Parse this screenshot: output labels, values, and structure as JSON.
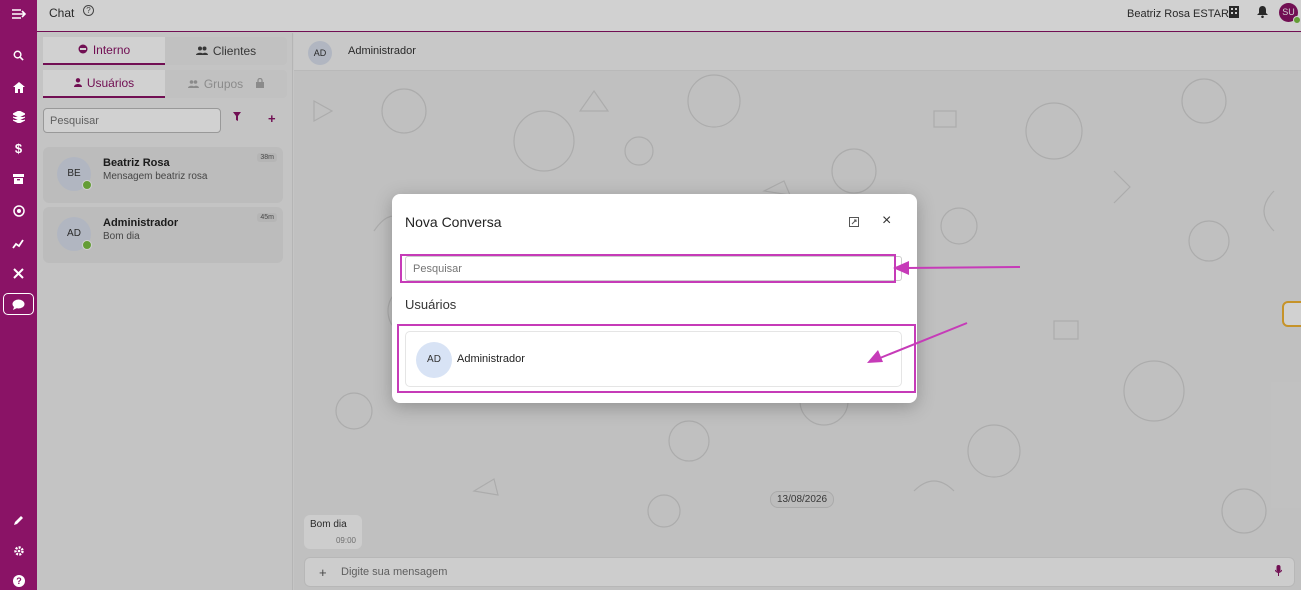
{
  "colors": {
    "brand": "#8a1366",
    "online": "#7bc043",
    "highlight": "#c63bb8",
    "accent_yellow": "#f2b433"
  },
  "rail": {
    "icons": [
      "menu-collapse-icon",
      "search-icon",
      "home-icon",
      "layers-icon",
      "dollar-icon",
      "archive-icon",
      "target-icon",
      "chart-icon",
      "tools-icon",
      "chat-icon",
      "pencil-icon",
      "gear-icon",
      "help-icon"
    ]
  },
  "topbar": {
    "title": "Chat",
    "user_name": "Beatriz Rosa ESTAR",
    "avatar_initials": "SU"
  },
  "sidebar": {
    "tabs_top": [
      {
        "label": "Interno",
        "icon": "headset-icon"
      },
      {
        "label": "Clientes",
        "icon": "people-icon"
      }
    ],
    "tabs_sub": [
      {
        "label": "Usuários",
        "icon": "user-icon"
      },
      {
        "label": "Grupos",
        "icon": "group-icon"
      }
    ],
    "search_placeholder": "Pesquisar",
    "conversations": [
      {
        "initials": "BE",
        "name": "Beatriz Rosa",
        "message": "Mensagem beatriz rosa",
        "time": "38m"
      },
      {
        "initials": "AD",
        "name": "Administrador",
        "message": "Bom dia",
        "time": "45m"
      }
    ]
  },
  "chat": {
    "header_initials": "AD",
    "header_name": "Administrador",
    "date_badge": "13/08/2026",
    "message_text": "Bom dia",
    "message_time": "09:00",
    "composer_plus": "+",
    "composer_placeholder": "Digite sua mensagem"
  },
  "modal": {
    "title": "Nova Conversa",
    "close": "×",
    "search_placeholder": "Pesquisar",
    "section_title": "Usuários",
    "users": [
      {
        "initials": "AD",
        "name": "Administrador"
      }
    ]
  }
}
